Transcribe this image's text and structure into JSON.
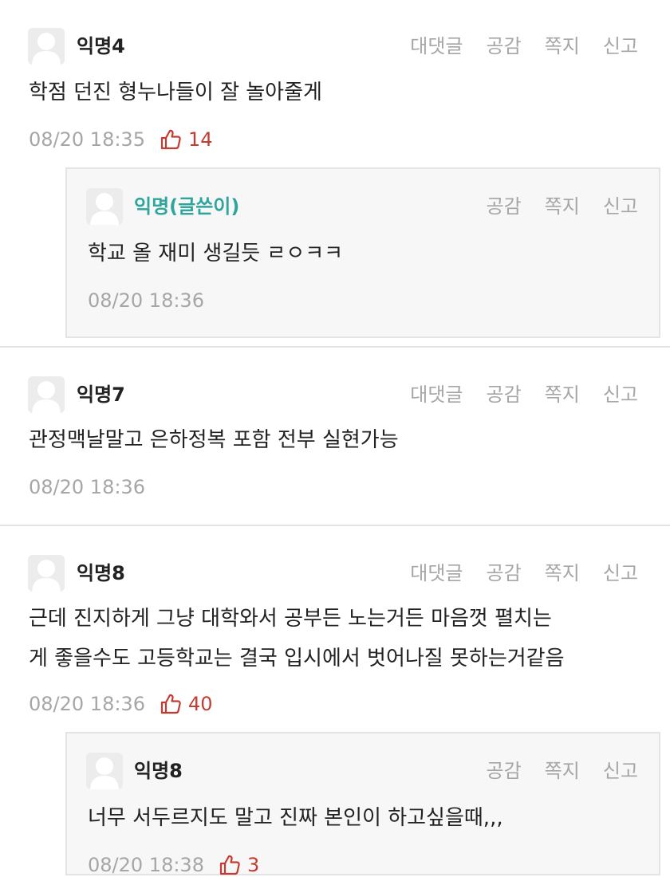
{
  "comments": [
    {
      "author": "익명4",
      "actions": [
        "대댓글",
        "공감",
        "쪽지",
        "신고"
      ],
      "text": "학점 던진 형누나들이 잘 놀아줄게",
      "time": "08/20 18:35",
      "likes": "14",
      "reply": {
        "author": "익명(글쓴이)",
        "actions": [
          "공감",
          "쪽지",
          "신고"
        ],
        "text": "학교 올 재미 생길듯 ㄹㅇㅋㅋ",
        "time": "08/20 18:36"
      }
    },
    {
      "author": "익명7",
      "actions": [
        "대댓글",
        "공감",
        "쪽지",
        "신고"
      ],
      "text": "관정맥날말고 은하정복 포함 전부 실현가능",
      "time": "08/20 18:36"
    },
    {
      "author": "익명8",
      "actions": [
        "대댓글",
        "공감",
        "쪽지",
        "신고"
      ],
      "text_lines": [
        "근데 진지하게 그냥 대학와서 공부든 노는거든 마음껏 펼치는",
        "게 좋을수도 고등학교는 결국 입시에서 벗어나질 못하는거같음"
      ],
      "time": "08/20 18:36",
      "likes": "40",
      "reply": {
        "author": "익명8",
        "actions": [
          "공감",
          "쪽지",
          "신고"
        ],
        "text": "너무 서두르지도 말고 진짜 본인이 하고싶을때,,,",
        "time": "08/20 18:38",
        "likes": "3"
      }
    }
  ],
  "colors": {
    "writer_nick": "#2fa59d",
    "like": "#c43c31",
    "muted": "#a6a6a6"
  }
}
